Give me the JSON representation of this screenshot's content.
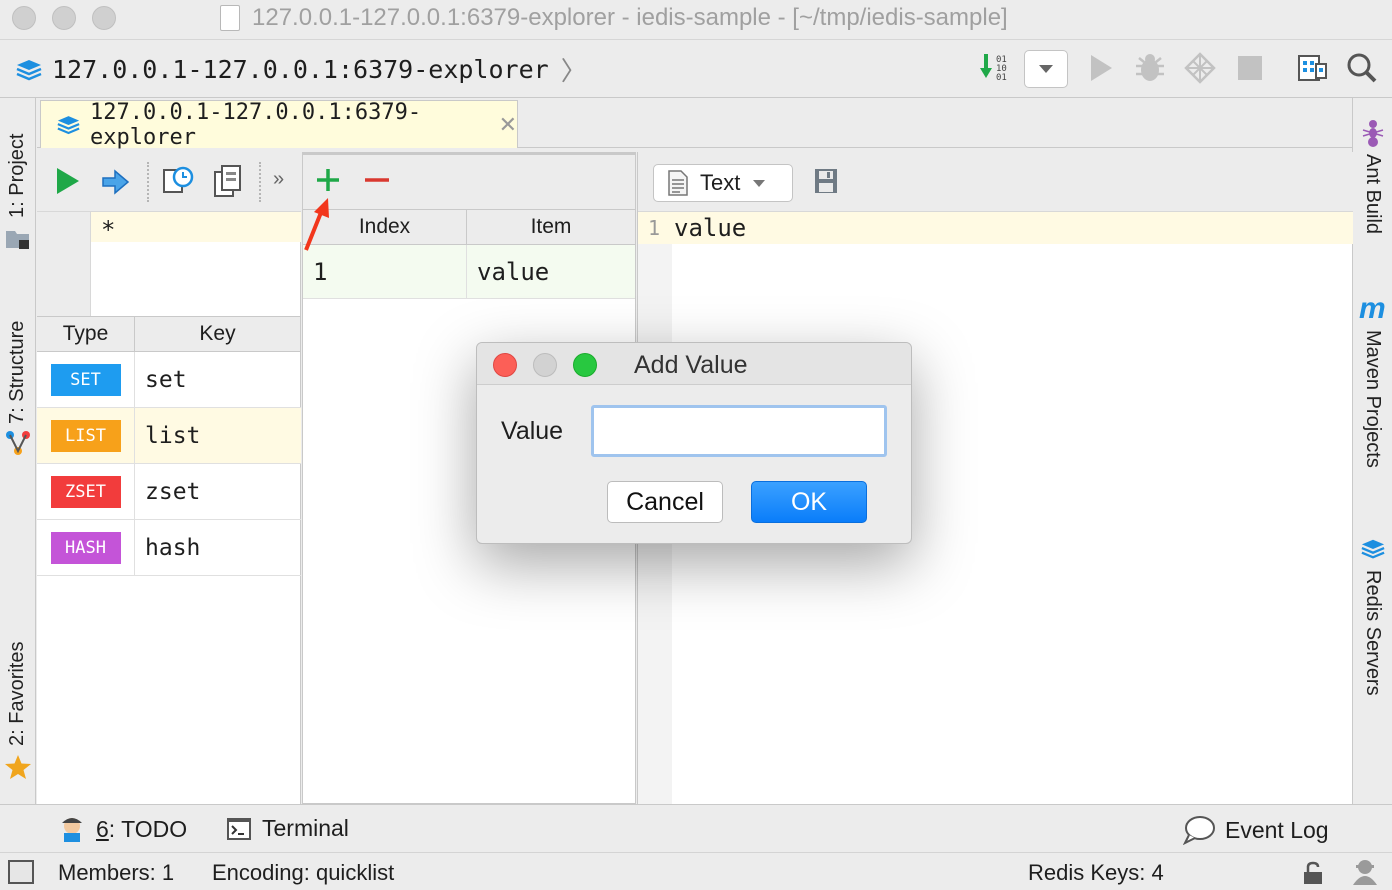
{
  "window": {
    "title": "127.0.0.1-127.0.0.1:6379-explorer - iedis-sample - [~/tmp/iedis-sample]"
  },
  "navbar": {
    "path": "127.0.0.1-127.0.0.1:6379-explorer"
  },
  "left_tool_windows": {
    "project": "1: Project",
    "structure": "7: Structure",
    "favorites": "2: Favorites"
  },
  "right_tool_windows": {
    "ant": "Ant Build",
    "maven": "Maven Projects",
    "redis": "Redis Servers"
  },
  "editor_tab": {
    "label": "127.0.0.1-127.0.0.1:6379-explorer"
  },
  "keys_panel": {
    "pattern": "*",
    "columns": [
      "Type",
      "Key"
    ],
    "rows": [
      {
        "type": "SET",
        "key": "set",
        "color": "#1e9cf0"
      },
      {
        "type": "LIST",
        "key": "list",
        "color": "#f7a11a"
      },
      {
        "type": "ZSET",
        "key": "zset",
        "color": "#f23c3c"
      },
      {
        "type": "HASH",
        "key": "hash",
        "color": "#c454d8"
      }
    ],
    "selected_key": "list"
  },
  "items_panel": {
    "columns": [
      "Index",
      "Item"
    ],
    "rows": [
      {
        "index": "1",
        "item": "value"
      }
    ]
  },
  "value_editor": {
    "format": "Text",
    "line_number": "1",
    "line_text": "value"
  },
  "bottom_tools": {
    "todo_prefix": "6",
    "todo_label": ": TODO",
    "terminal": "Terminal",
    "event_log": "Event Log"
  },
  "status_bar": {
    "members": "Members: 1",
    "encoding": "Encoding: quicklist",
    "redis_keys": "Redis Keys: 4"
  },
  "dialog": {
    "title": "Add Value",
    "label": "Value",
    "input_value": "",
    "cancel": "Cancel",
    "ok": "OK"
  },
  "colors": {
    "accent_blue": "#0a7dfa",
    "run_green": "#1fa848",
    "remove_red": "#d9382f",
    "annotation_arrow": "#f2361c"
  }
}
